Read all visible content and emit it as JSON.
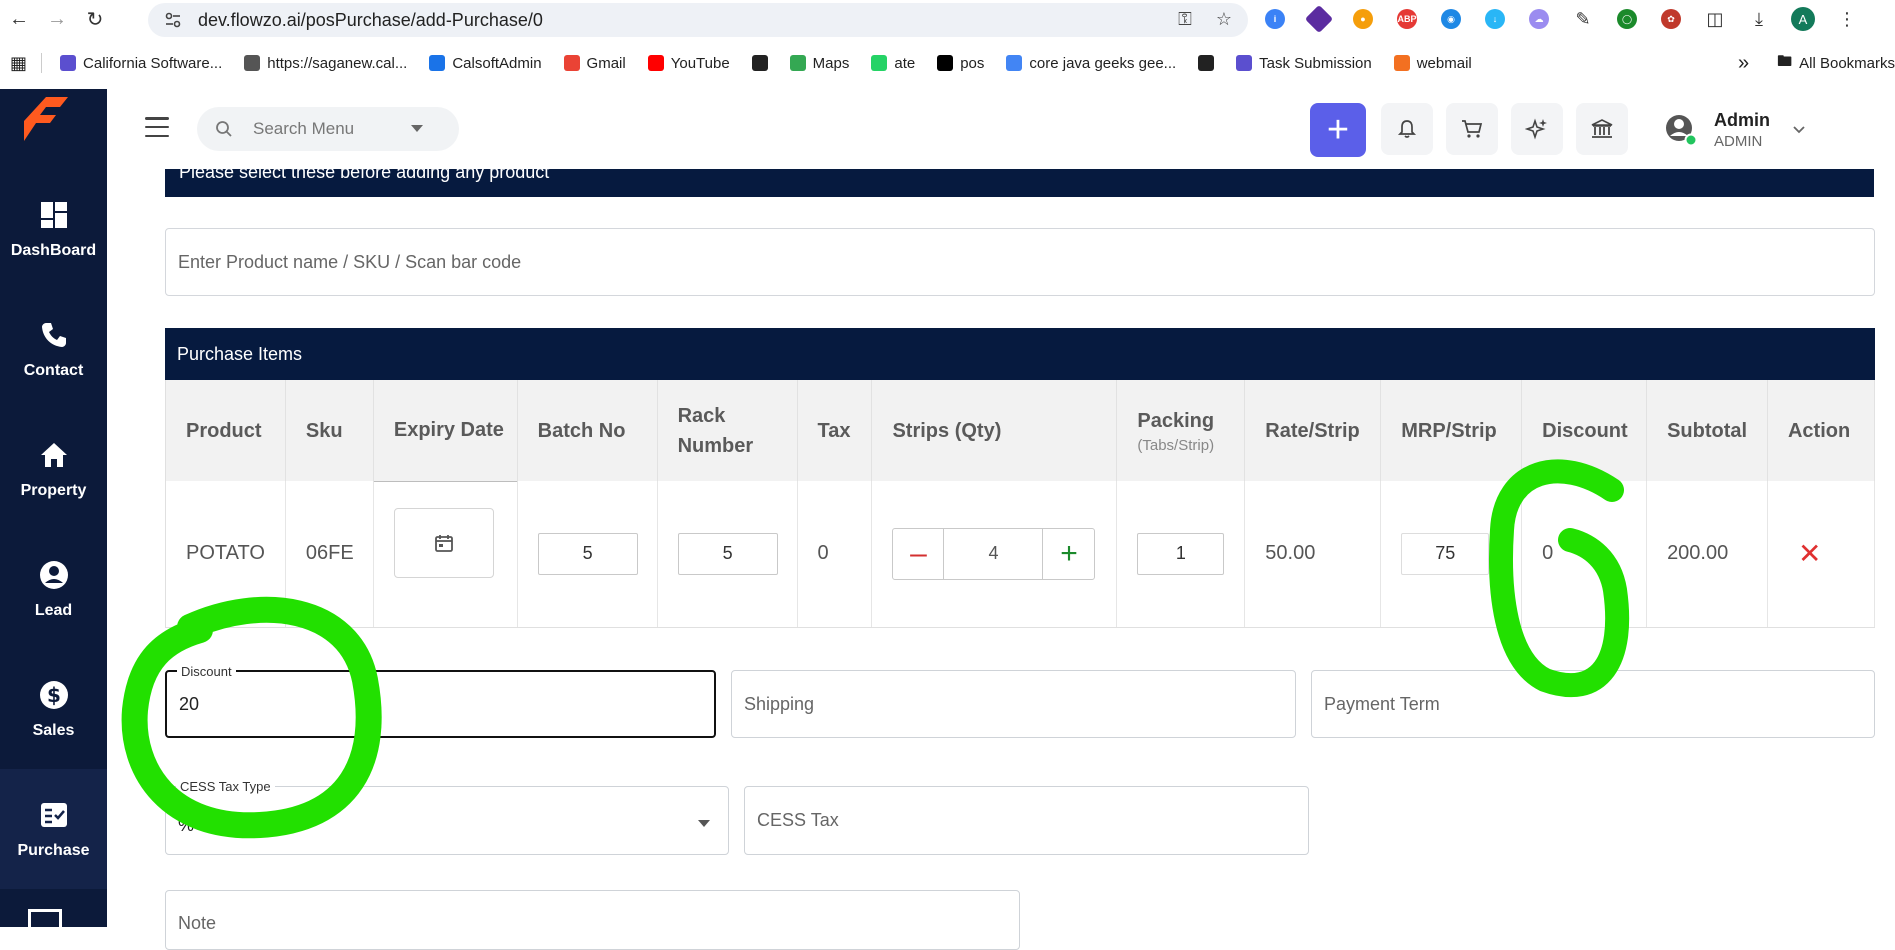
{
  "browser": {
    "url": "dev.flowzo.ai/posPurchase/add-Purchase/0",
    "profile_initial": "A",
    "bookmarks": [
      {
        "label": "California Software...",
        "color": "#5b4fcf"
      },
      {
        "label": "https://saganew.cal...",
        "color": "#555555"
      },
      {
        "label": "CalsoftAdmin",
        "color": "#1a73e8"
      },
      {
        "label": "Gmail",
        "color": "#ea4335"
      },
      {
        "label": "YouTube",
        "color": "#ff0000"
      },
      {
        "label": "",
        "color": "#222222"
      },
      {
        "label": "Maps",
        "color": "#34a853"
      },
      {
        "label": "ate",
        "color": "#25d366"
      },
      {
        "label": "pos",
        "color": "#000000"
      },
      {
        "label": "core java geeks gee...",
        "color": "#4285f4"
      },
      {
        "label": "",
        "color": "#222222"
      },
      {
        "label": "Task Submission",
        "color": "#5b4fcf"
      },
      {
        "label": "webmail",
        "color": "#f37021"
      }
    ],
    "more_bookmarks": "»",
    "all_bookmarks": "All Bookmarks"
  },
  "sidebar": {
    "items": [
      {
        "label": "DashBoard",
        "icon": "dashboard-icon"
      },
      {
        "label": "Contact",
        "icon": "phone-icon"
      },
      {
        "label": "Property",
        "icon": "home-icon"
      },
      {
        "label": "Lead",
        "icon": "account-circle-icon"
      },
      {
        "label": "Sales",
        "icon": "dollar-icon"
      },
      {
        "label": "Purchase",
        "icon": "checklist-icon",
        "active": true
      }
    ]
  },
  "header": {
    "search_placeholder": "Search Menu",
    "user_name": "Admin",
    "user_role": "ADMIN",
    "accent": "#5b5fe9"
  },
  "content": {
    "banner_text": "Please select these before adding any product",
    "product_search_placeholder": "Enter Product name / SKU / Scan bar code",
    "purchase_items_title": "Purchase Items",
    "columns": [
      {
        "label": "Product"
      },
      {
        "label": "Sku"
      },
      {
        "label": "Expiry Date"
      },
      {
        "label": "Batch No"
      },
      {
        "label": "Rack Number"
      },
      {
        "label": "Tax"
      },
      {
        "label": "Strips (Qty)"
      },
      {
        "label": "Packing",
        "sub": "(Tabs/Strip)"
      },
      {
        "label": "Rate/Strip"
      },
      {
        "label": "MRP/Strip"
      },
      {
        "label": "Discount"
      },
      {
        "label": "Subtotal"
      },
      {
        "label": "Action"
      }
    ],
    "row": {
      "product": "POTATO",
      "sku": "06FE",
      "batch_no": "5",
      "rack_number": "5",
      "tax": "0",
      "qty": "4",
      "packing": "1",
      "rate": "50.00",
      "mrp": "75",
      "discount": "0",
      "subtotal": "200.00"
    },
    "form": {
      "discount_label": "Discount",
      "discount_value": "20",
      "shipping_placeholder": "Shipping",
      "payment_term_placeholder": "Payment Term",
      "cess_type_label": "CESS Tax Type",
      "cess_type_value": "%",
      "cess_tax_placeholder": "CESS Tax",
      "note_placeholder": "Note"
    }
  },
  "annotation_color": "#22e000"
}
